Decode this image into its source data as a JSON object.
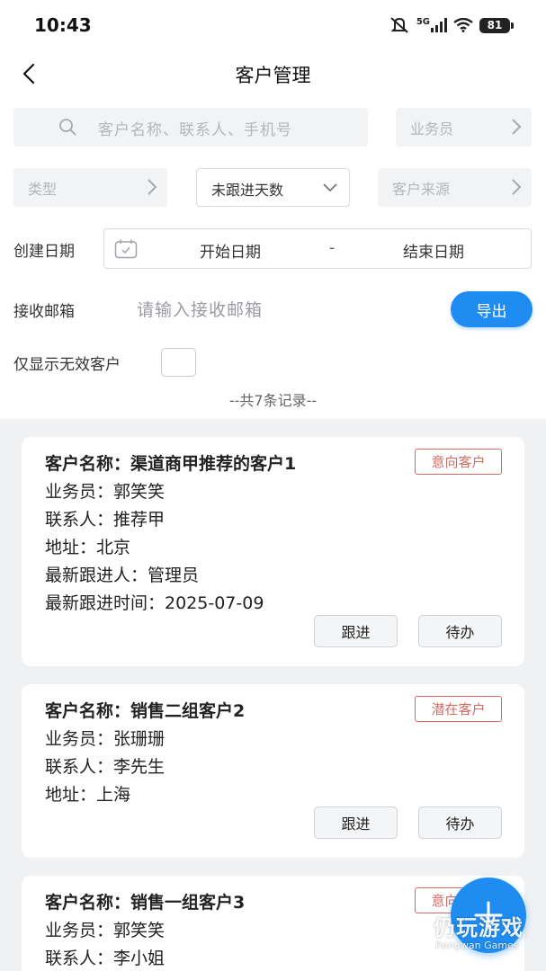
{
  "status_bar": {
    "time": "10:43",
    "network_label": "5G",
    "battery": "81"
  },
  "header": {
    "title": "客户管理",
    "back_icon": "chevron-left-icon"
  },
  "filters": {
    "search_placeholder": "客户名称、联系人、手机号",
    "salesman_placeholder": "业务员",
    "type_placeholder": "类型",
    "days_value": "未跟进天数",
    "source_placeholder": "客户来源",
    "create_date_label": "创建日期",
    "start_date": "开始日期",
    "date_separator": "-",
    "end_date": "结束日期",
    "email_label": "接收邮箱",
    "email_placeholder": "请输入接收邮箱",
    "export_label": "导出",
    "invalid_only_label": "仅显示无效客户",
    "invalid_only_checked": false,
    "record_count": "--共7条记录--"
  },
  "customers": [
    {
      "name": "客户名称：渠道商甲推荐的客户1",
      "tag": "意向客户",
      "salesman": "业务员：郭笑笑",
      "contact": "联系人：推荐甲",
      "address": "地址：北京",
      "latest_follower": "最新跟进人：管理员",
      "latest_follow_time": "最新跟进时间：2025-07-09",
      "follow_label": "跟进",
      "todo_label": "待办"
    },
    {
      "name": "客户名称：销售二组客户2",
      "tag": "潜在客户",
      "salesman": "业务员：张珊珊",
      "contact": "联系人：李先生",
      "address": "地址：上海",
      "follow_label": "跟进",
      "todo_label": "待办"
    },
    {
      "name": "客户名称：销售一组客户3",
      "tag": "意向客户",
      "salesman": "业务员：郭笑笑",
      "contact": "联系人：李小姐"
    }
  ],
  "fab": {
    "icon": "plus-icon"
  },
  "watermark": {
    "cn": "仍玩游戏",
    "en": "Rengwan Games"
  },
  "colors": {
    "accent": "#1f8cf2",
    "tag_red": "#d46b63",
    "list_bg": "#f0f1f3"
  }
}
